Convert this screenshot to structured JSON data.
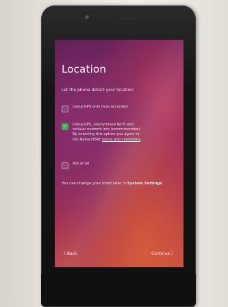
{
  "screen": {
    "title": "Location",
    "subtitle": "Let the phone detect your location:",
    "options": [
      {
        "label": "Using GPS only (less accurate)",
        "checked": false
      },
      {
        "label_lines": [
          "Using GPS, anonymised Wi-Fi and",
          "cellular network info (recommended)",
          "By selecting this option you agree to",
          "the Nokia HERE "
        ],
        "link": "terms and conditions",
        "link_suffix": ".",
        "checked": true
      },
      {
        "label": "Not at all",
        "checked": false
      }
    ],
    "note_prefix": "You can change your mind later in ",
    "note_strong": "System Settings",
    "note_suffix": ".",
    "back_label": "〈 Back",
    "continue_label": "Continue 〉"
  },
  "colors": {
    "checkbox_checked": "#3fae5b",
    "text": "#f4eef2"
  }
}
